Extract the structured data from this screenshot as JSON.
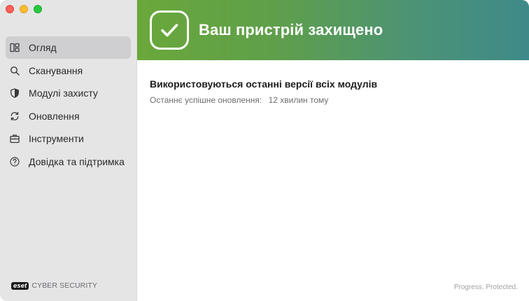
{
  "window": {
    "traffic_lights": [
      "close",
      "minimize",
      "maximize"
    ]
  },
  "sidebar": {
    "items": [
      {
        "label": "Огляд",
        "icon": "dashboard-icon",
        "active": true
      },
      {
        "label": "Сканування",
        "icon": "search-icon",
        "active": false
      },
      {
        "label": "Модулі захисту",
        "icon": "shield-icon",
        "active": false
      },
      {
        "label": "Оновлення",
        "icon": "refresh-icon",
        "active": false
      },
      {
        "label": "Інструменти",
        "icon": "briefcase-icon",
        "active": false
      },
      {
        "label": "Довідка та підтримка",
        "icon": "help-icon",
        "active": false
      }
    ],
    "brand": {
      "logo": "eset",
      "product": "CYBER SECURITY"
    }
  },
  "banner": {
    "title": "Ваш пристрій захищено",
    "icon": "checkmark-icon",
    "colors": {
      "start": "#6aa83b",
      "end": "#3e8a89"
    }
  },
  "status": {
    "title": "Використовуються останні версії всіх модулів",
    "last_update_label": "Останнє успішне оновлення:",
    "last_update_value": "12 хвилин тому"
  },
  "footer": {
    "slogan": "Progress. Protected."
  }
}
